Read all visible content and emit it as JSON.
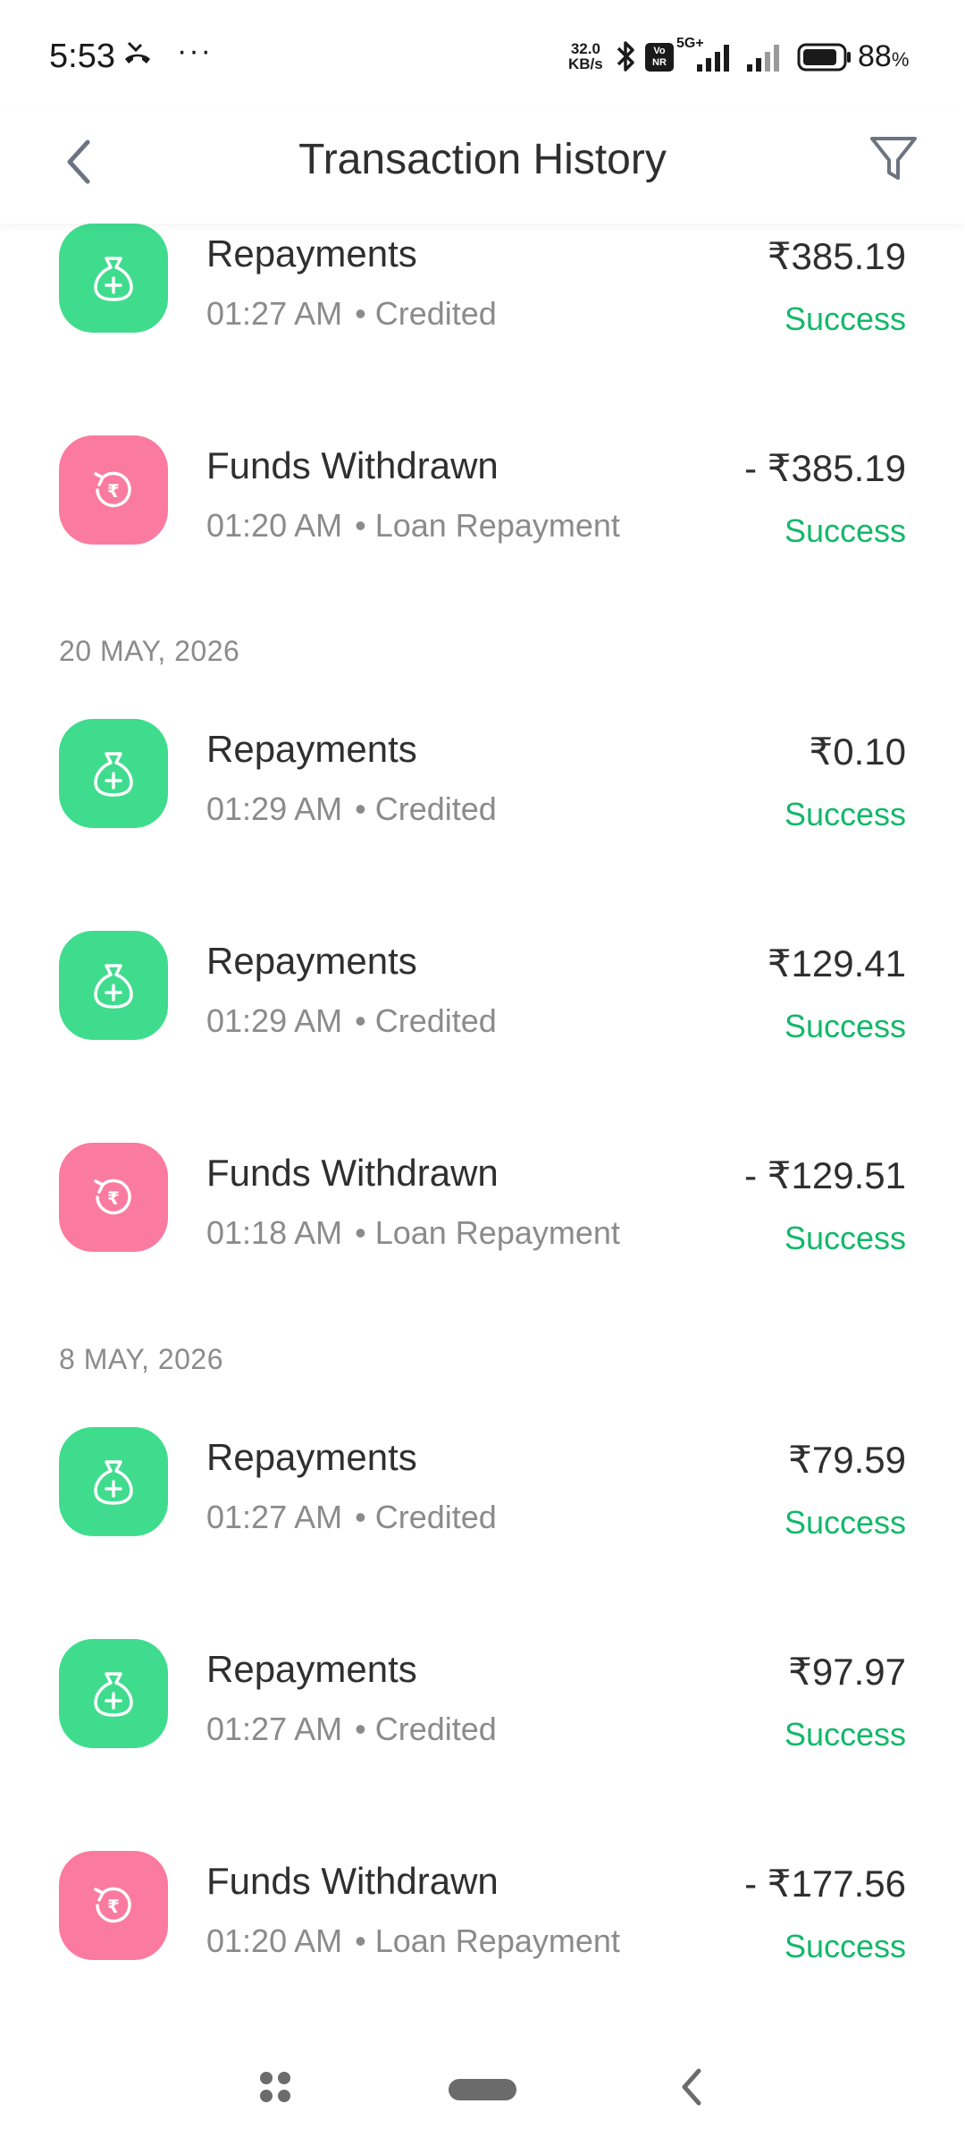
{
  "status_bar": {
    "time": "5:53",
    "more": "···",
    "net_speed_value": "32.0",
    "net_speed_unit": "KB/s",
    "volte": "Vo NR",
    "network_type": "5G+",
    "battery_percent": "88",
    "battery_unit": "%",
    "battery_level": 0.88
  },
  "header": {
    "title": "Transaction History"
  },
  "transactions": [
    {
      "type": "credit",
      "title": "Repayments",
      "time": "01:27 AM",
      "bullet": "•",
      "category": "Credited",
      "amount": "₹385.19",
      "status": "Success"
    },
    {
      "type": "debit",
      "title": "Funds Withdrawn",
      "time": "01:20 AM",
      "bullet": "•",
      "category": "Loan Repayment",
      "amount": "- ₹385.19",
      "status": "Success"
    }
  ],
  "groups": [
    {
      "date": "20 MAY, 2026",
      "items": [
        {
          "type": "credit",
          "title": "Repayments",
          "time": "01:29 AM",
          "bullet": "•",
          "category": "Credited",
          "amount": "₹0.10",
          "status": "Success"
        },
        {
          "type": "credit",
          "title": "Repayments",
          "time": "01:29 AM",
          "bullet": "•",
          "category": "Credited",
          "amount": "₹129.41",
          "status": "Success"
        },
        {
          "type": "debit",
          "title": "Funds Withdrawn",
          "time": "01:18 AM",
          "bullet": "•",
          "category": "Loan Repayment",
          "amount": "- ₹129.51",
          "status": "Success"
        }
      ]
    },
    {
      "date": "8 MAY, 2026",
      "items": [
        {
          "type": "credit",
          "title": "Repayments",
          "time": "01:27 AM",
          "bullet": "•",
          "category": "Credited",
          "amount": "₹79.59",
          "status": "Success"
        },
        {
          "type": "credit",
          "title": "Repayments",
          "time": "01:27 AM",
          "bullet": "•",
          "category": "Credited",
          "amount": "₹97.97",
          "status": "Success"
        },
        {
          "type": "debit",
          "title": "Funds Withdrawn",
          "time": "01:20 AM",
          "bullet": "•",
          "category": "Loan Repayment",
          "amount": "- ₹177.56",
          "status": "Success"
        }
      ]
    }
  ],
  "colors": {
    "credit_icon_bg": "#3fdc8e",
    "debit_icon_bg": "#fb7aa0",
    "success_text": "#14b86a"
  },
  "icons": {
    "credit": "money-bag-plus-icon",
    "debit": "rupee-refund-icon"
  }
}
